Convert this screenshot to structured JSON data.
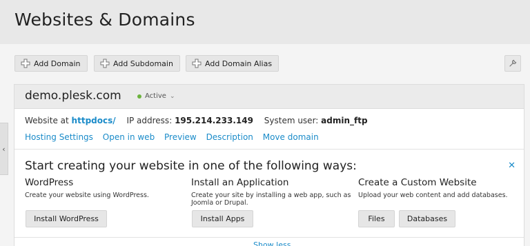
{
  "header": {
    "title": "Websites & Domains"
  },
  "toolbar": {
    "add_domain": "Add Domain",
    "add_subdomain": "Add Subdomain",
    "add_domain_alias": "Add Domain Alias"
  },
  "domain": {
    "name": "demo.plesk.com",
    "status": "Active",
    "status_color": "#6cb33e",
    "website_at_label": "Website at",
    "website_at_value": "httpdocs/",
    "ip_label": "IP address:",
    "ip_value": "195.214.233.149",
    "user_label": "System user:",
    "user_value": "admin_ftp",
    "links": [
      "Hosting Settings",
      "Open in web",
      "Preview",
      "Description",
      "Move domain"
    ]
  },
  "start": {
    "title": "Start creating your website in one of the following ways:",
    "options": [
      {
        "heading": "WordPress",
        "description": "Create your website using WordPress.",
        "buttons": [
          "Install WordPress"
        ]
      },
      {
        "heading": "Install an Application",
        "description": "Create your site by installing a web app, such as Joomla or Drupal.",
        "buttons": [
          "Install Apps"
        ]
      },
      {
        "heading": "Create a Custom Website",
        "description": "Upload your web content and add databases.",
        "buttons": [
          "Files",
          "Databases"
        ]
      }
    ],
    "bottom_link": "Show less"
  },
  "colors": {
    "link": "#1a8bc9",
    "accent_active": "#6cb33e"
  }
}
